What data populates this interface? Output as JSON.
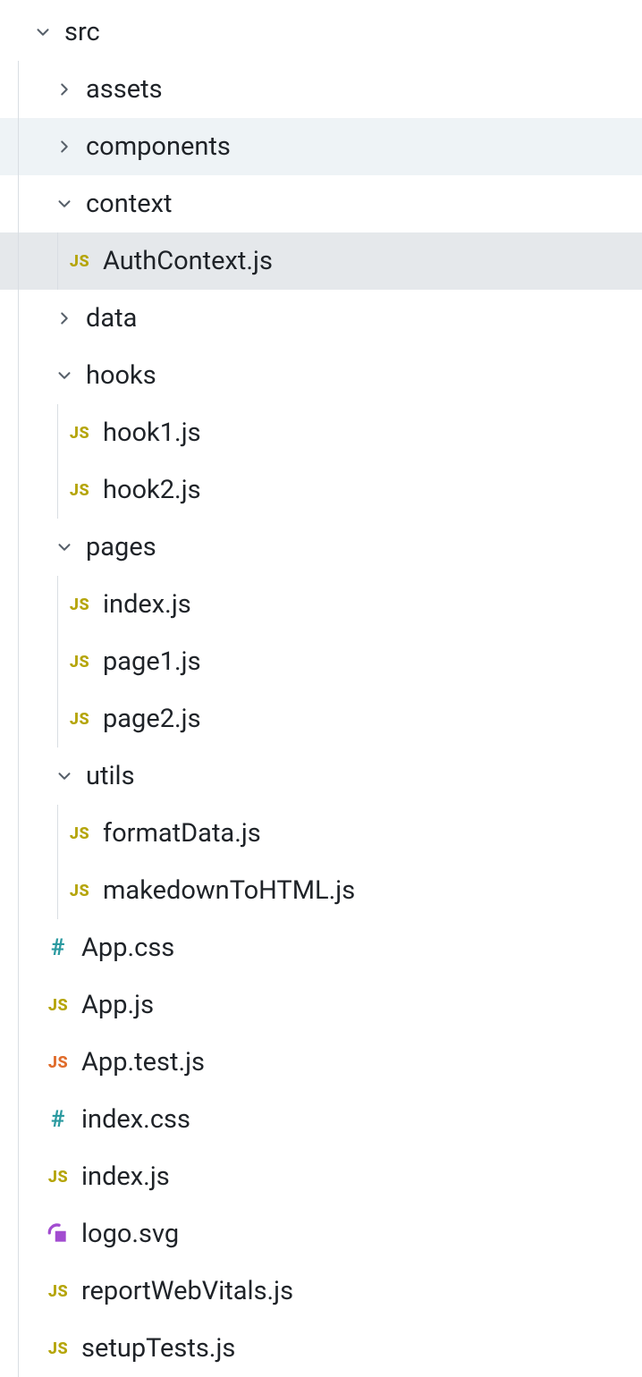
{
  "tree": {
    "root": {
      "name": "src",
      "expanded": true
    },
    "folders": {
      "assets": {
        "name": "assets",
        "expanded": false,
        "highlight": null
      },
      "components": {
        "name": "components",
        "expanded": false,
        "highlight": "hover"
      },
      "context": {
        "name": "context",
        "expanded": true,
        "highlight": null
      },
      "data": {
        "name": "data",
        "expanded": false,
        "highlight": null
      },
      "hooks": {
        "name": "hooks",
        "expanded": true,
        "highlight": null
      },
      "pages": {
        "name": "pages",
        "expanded": true,
        "highlight": null
      },
      "utils": {
        "name": "utils",
        "expanded": true,
        "highlight": null
      }
    },
    "files": {
      "authcontext": {
        "name": "AuthContext.js",
        "type": "js",
        "highlight": "selected"
      },
      "hook1": {
        "name": "hook1.js",
        "type": "js"
      },
      "hook2": {
        "name": "hook2.js",
        "type": "js"
      },
      "pages_index": {
        "name": "index.js",
        "type": "js"
      },
      "page1": {
        "name": "page1.js",
        "type": "js"
      },
      "page2": {
        "name": "page2.js",
        "type": "js"
      },
      "formatdata": {
        "name": "formatData.js",
        "type": "js"
      },
      "makedowntohtml": {
        "name": "makedownToHTML.js",
        "type": "js"
      },
      "app_css": {
        "name": "App.css",
        "type": "css"
      },
      "app_js": {
        "name": "App.js",
        "type": "js"
      },
      "app_test": {
        "name": "App.test.js",
        "type": "test"
      },
      "index_css": {
        "name": "index.css",
        "type": "css"
      },
      "index_js": {
        "name": "index.js",
        "type": "js"
      },
      "logo_svg": {
        "name": "logo.svg",
        "type": "svg"
      },
      "reportwebvitals": {
        "name": "reportWebVitals.js",
        "type": "js"
      },
      "setuptests": {
        "name": "setupTests.js",
        "type": "js"
      }
    }
  },
  "icons": {
    "js_badge": "JS",
    "css_badge": "#"
  }
}
